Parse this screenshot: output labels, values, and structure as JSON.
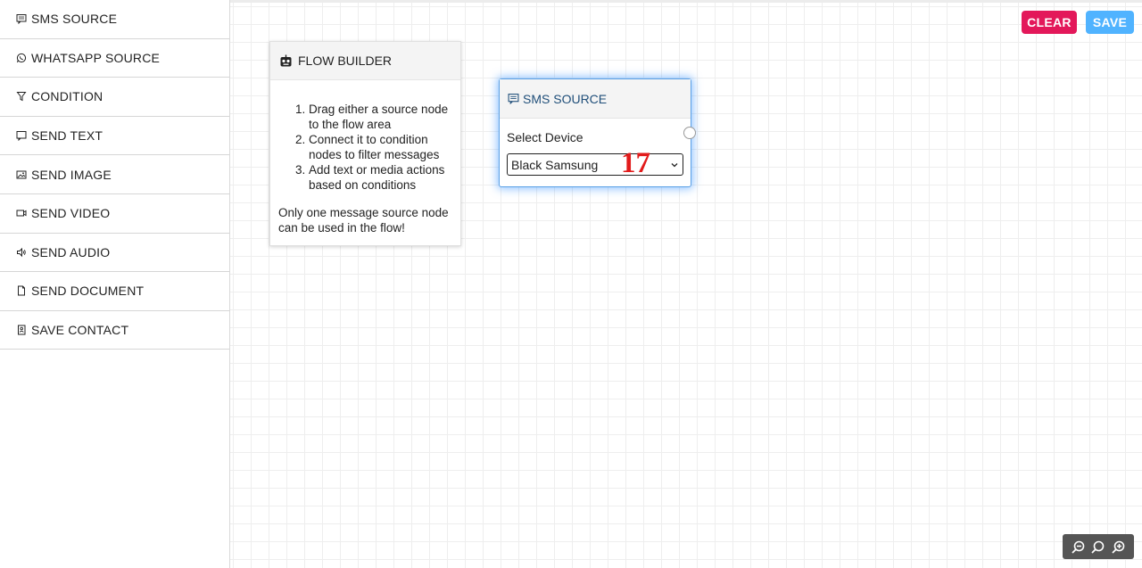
{
  "sidebar": {
    "items": [
      {
        "label": "SMS SOURCE",
        "icon": "message-icon"
      },
      {
        "label": "WHATSAPP SOURCE",
        "icon": "whatsapp-icon"
      },
      {
        "label": "CONDITION",
        "icon": "filter-icon"
      },
      {
        "label": "SEND TEXT",
        "icon": "chat-icon"
      },
      {
        "label": "SEND IMAGE",
        "icon": "image-icon"
      },
      {
        "label": "SEND VIDEO",
        "icon": "video-icon"
      },
      {
        "label": "SEND AUDIO",
        "icon": "speaker-icon"
      },
      {
        "label": "SEND DOCUMENT",
        "icon": "document-icon"
      },
      {
        "label": "SAVE CONTACT",
        "icon": "contact-icon"
      }
    ]
  },
  "toolbar": {
    "clear_label": "CLEAR",
    "save_label": "SAVE",
    "clear_color": "#e3185a",
    "save_color": "#50b3ff"
  },
  "help": {
    "title": "FLOW BUILDER",
    "steps": [
      "Drag either a source node to the flow area",
      "Connect it to condition nodes to filter messages",
      "Add text or media actions based on conditions"
    ],
    "note": "Only one message source node can be used in the flow!"
  },
  "node": {
    "title": "SMS SOURCE",
    "field_label": "Select Device",
    "selected_device": "Black Samsung"
  },
  "overlay": {
    "number": "17"
  },
  "zoom": {
    "icons": [
      "zoom-out-icon",
      "zoom-reset-icon",
      "zoom-in-icon"
    ]
  }
}
